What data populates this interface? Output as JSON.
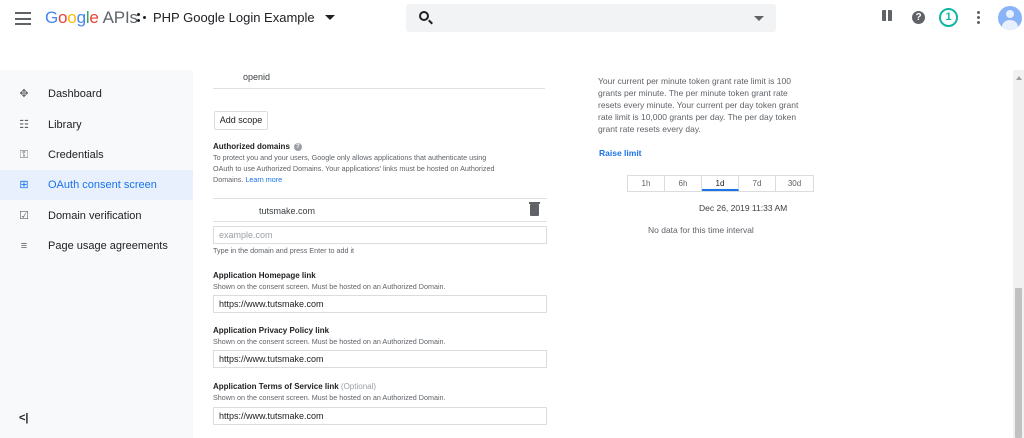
{
  "header": {
    "logo_letters": [
      "G",
      "o",
      "o",
      "g",
      "l",
      "e"
    ],
    "logo_suffix": "APIs",
    "project_name": "PHP Google Login Example",
    "notification_count": "1",
    "help_glyph": "?",
    "icons": [
      "menu-icon",
      "project-icon",
      "search-icon",
      "gift-icon",
      "help-icon",
      "notification-icon",
      "more-vert-icon",
      "avatar-icon"
    ]
  },
  "sidebar": {
    "items": [
      {
        "label": "Dashboard",
        "icon": "dashboard-icon",
        "glyph": "✥"
      },
      {
        "label": "Library",
        "icon": "library-icon",
        "glyph": "☷"
      },
      {
        "label": "Credentials",
        "icon": "key-icon",
        "glyph": "⚿"
      },
      {
        "label": "OAuth consent screen",
        "icon": "consent-icon",
        "glyph": "⊞"
      },
      {
        "label": "Domain verification",
        "icon": "domain-icon",
        "glyph": "☑"
      },
      {
        "label": "Page usage agreements",
        "icon": "agreements-icon",
        "glyph": "≡"
      }
    ],
    "active_index": 3,
    "collapse_label": "<|"
  },
  "form": {
    "scope_item": "openid",
    "add_scope_label": "Add scope",
    "authorized_domains": {
      "title": "Authorized domains",
      "help_line1": "To protect you and your users, Google only allows applications that authenticate using",
      "help_line2": "OAuth to use Authorized Domains. Your applications' links must be hosted on Authorized",
      "help_line3": "Domains.",
      "learn_more": "Learn more",
      "domain": "tutsmake.com",
      "input_placeholder": "example.com",
      "input_hint": "Type in the domain and press Enter to add it"
    },
    "homepage": {
      "title": "Application Homepage link",
      "help": "Shown on the consent screen. Must be hosted on an Authorized Domain.",
      "value": "https://www.tutsmake.com"
    },
    "privacy": {
      "title": "Application Privacy Policy link",
      "help": "Shown on the consent screen. Must be hosted on an Authorized Domain.",
      "value": "https://www.tutsmake.com"
    },
    "terms": {
      "title": "Application Terms of Service link",
      "optional": "(Optional)",
      "help": "Shown on the consent screen. Must be hosted on an Authorized Domain.",
      "value": "https://www.tutsmake.com"
    }
  },
  "quota": {
    "line1": "Your current per minute token grant rate limit is 100",
    "line2": "grants per minute. The per minute token grant rate",
    "line3": "resets every minute. Your current per day token grant",
    "line4": "rate limit is 10,000 grants per day. The per day token",
    "line5": "grant rate resets every day.",
    "raise_limit": "Raise limit",
    "tabs": [
      "1h",
      "6h",
      "1d",
      "7d",
      "30d"
    ],
    "active_tab": "1d",
    "date": "Dec 26, 2019 11:33 AM",
    "no_data": "No data for this time interval"
  },
  "colors": {
    "accent": "#1a73e8",
    "active_bg": "#e8f0fe",
    "sidebar_bg": "#f8f9fa",
    "notification": "#12b5a5"
  }
}
